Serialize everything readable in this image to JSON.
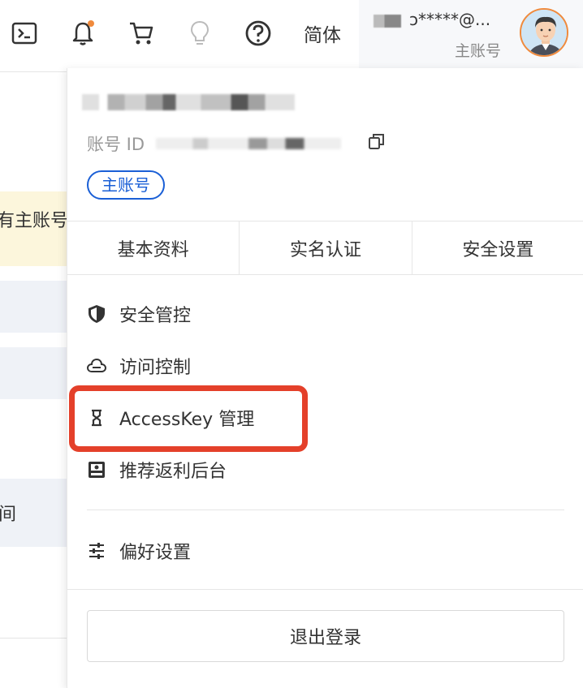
{
  "topbar": {
    "lang_label": "简体",
    "user_email": "ɔ*****@...",
    "user_role": "主账号",
    "notification_dot_color": "#f08a3c"
  },
  "background": {
    "notice_text": "有主账号",
    "row_text": "间"
  },
  "account_panel": {
    "id_label": "账号 ID",
    "badge": "主账号",
    "tabs": [
      "基本资料",
      "实名认证",
      "安全设置"
    ],
    "menu": [
      {
        "label": "安全管控",
        "icon": "shield-icon"
      },
      {
        "label": "访问控制",
        "icon": "cloud-icon"
      },
      {
        "label": "AccessKey 管理",
        "icon": "accesskey-icon"
      },
      {
        "label": "推荐返利后台",
        "icon": "rebate-icon"
      },
      {
        "label": "偏好设置",
        "icon": "sliders-icon"
      }
    ],
    "logout_label": "退出登录",
    "highlight_color": "#e4402a",
    "accent_color": "#1a5fd6"
  }
}
